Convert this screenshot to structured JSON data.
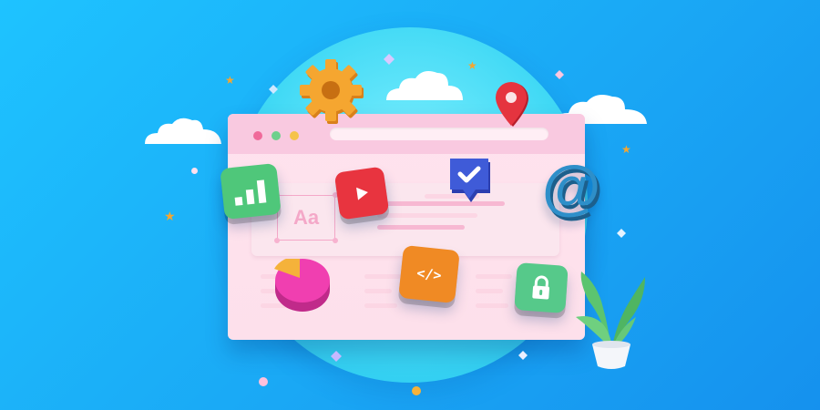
{
  "illustration": {
    "font_sample_text": "Aa",
    "code_icon_text": "</>",
    "at_symbol": "@"
  },
  "colors": {
    "background": "#1aa8f5",
    "window": "#fde0eb",
    "titlebar": "#f9c9e0",
    "dot_red": "#f06a9a",
    "dot_green": "#6fd08c",
    "dot_yellow": "#f5c34a",
    "chart_tile": "#4fc77a",
    "play_tile": "#e8343f",
    "check_tile": "#3f5bd8",
    "code_tile": "#f08a24",
    "lock_tile": "#56c98a",
    "gear": "#f2a02a",
    "pin": "#e5343f",
    "pie_magenta": "#f03fb0",
    "pie_orange": "#f5b23a"
  },
  "icons": [
    "gear-icon",
    "location-pin-icon",
    "bar-chart-icon",
    "play-icon",
    "checkmark-badge-icon",
    "at-sign-icon",
    "pie-chart-icon",
    "code-icon",
    "padlock-icon",
    "potted-plant-icon",
    "cloud-icon",
    "star-icon"
  ]
}
